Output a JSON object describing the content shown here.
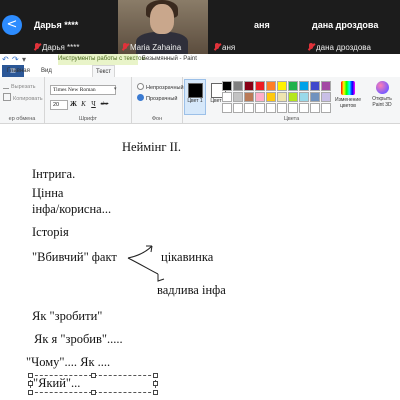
{
  "call": {
    "back_button": "<",
    "participants": [
      {
        "name": "Дарья ****",
        "label": "Дарья ****"
      },
      {
        "name": "",
        "label": "Maria Zahaina"
      },
      {
        "name": "аня",
        "label": "аня"
      },
      {
        "name": "дана дроздова",
        "label": "дана дроздова"
      }
    ],
    "mic_status": "muted"
  },
  "paint": {
    "context_tab": "Инструменты работы с текстом",
    "document_title": "Безымянный - Paint",
    "tabs": [
      "Главная",
      "Вид",
      "Текст"
    ],
    "active_tab": "Текст",
    "clipboard": {
      "cut": "Вырезать",
      "copy": "Копировать",
      "label": "ер обмена"
    },
    "font": {
      "family": "Times New Roman",
      "size": "20",
      "label": "Шрифт",
      "bold": "Ж",
      "italic": "К",
      "underline": "Ч",
      "strike": "abe"
    },
    "background": {
      "opaque": "Непрозрачный",
      "transparent": "Прозрачный",
      "label": "Фон",
      "selected": "transparent"
    },
    "colors": {
      "color1_label": "Цвет 1",
      "color2_label": "Цвет 2",
      "color1": "#000000",
      "color2": "#ffffff",
      "edit_label": "Изменение цветов",
      "paint3d_label": "Открыть Paint 3D",
      "group_label": "Цвета",
      "palette_row1": [
        "#000000",
        "#7f7f7f",
        "#880015",
        "#ed1c24",
        "#ff7f27",
        "#fff200",
        "#22b14c",
        "#00a2e8",
        "#3f48cc",
        "#a349a4"
      ],
      "palette_row2": [
        "#ffffff",
        "#c3c3c3",
        "#b97a57",
        "#ffaec9",
        "#ffc90e",
        "#efe4b0",
        "#b5e61d",
        "#99d9ea",
        "#7092be",
        "#c8bfe7"
      ],
      "palette_row3": [
        "#ffffff",
        "#ffffff",
        "#ffffff",
        "#ffffff",
        "#ffffff",
        "#ffffff",
        "#ffffff",
        "#ffffff",
        "#ffffff",
        "#ffffff"
      ]
    }
  },
  "canvas_text": {
    "title": "Неймінг II.",
    "l1": "Інтрига.",
    "l2": "Цінна",
    "l3": "інфа/корисна...",
    "l4": "Історія",
    "l5": "\"Вбивчий\" факт",
    "l6": "цікавинка",
    "l7": "вадлива інфа",
    "l8": "Як \"зробити\"",
    "l9": "Як я \"зробив\".....",
    "l10": "\"Чому\".... Як  ....",
    "l11": "\"Який\"..."
  }
}
